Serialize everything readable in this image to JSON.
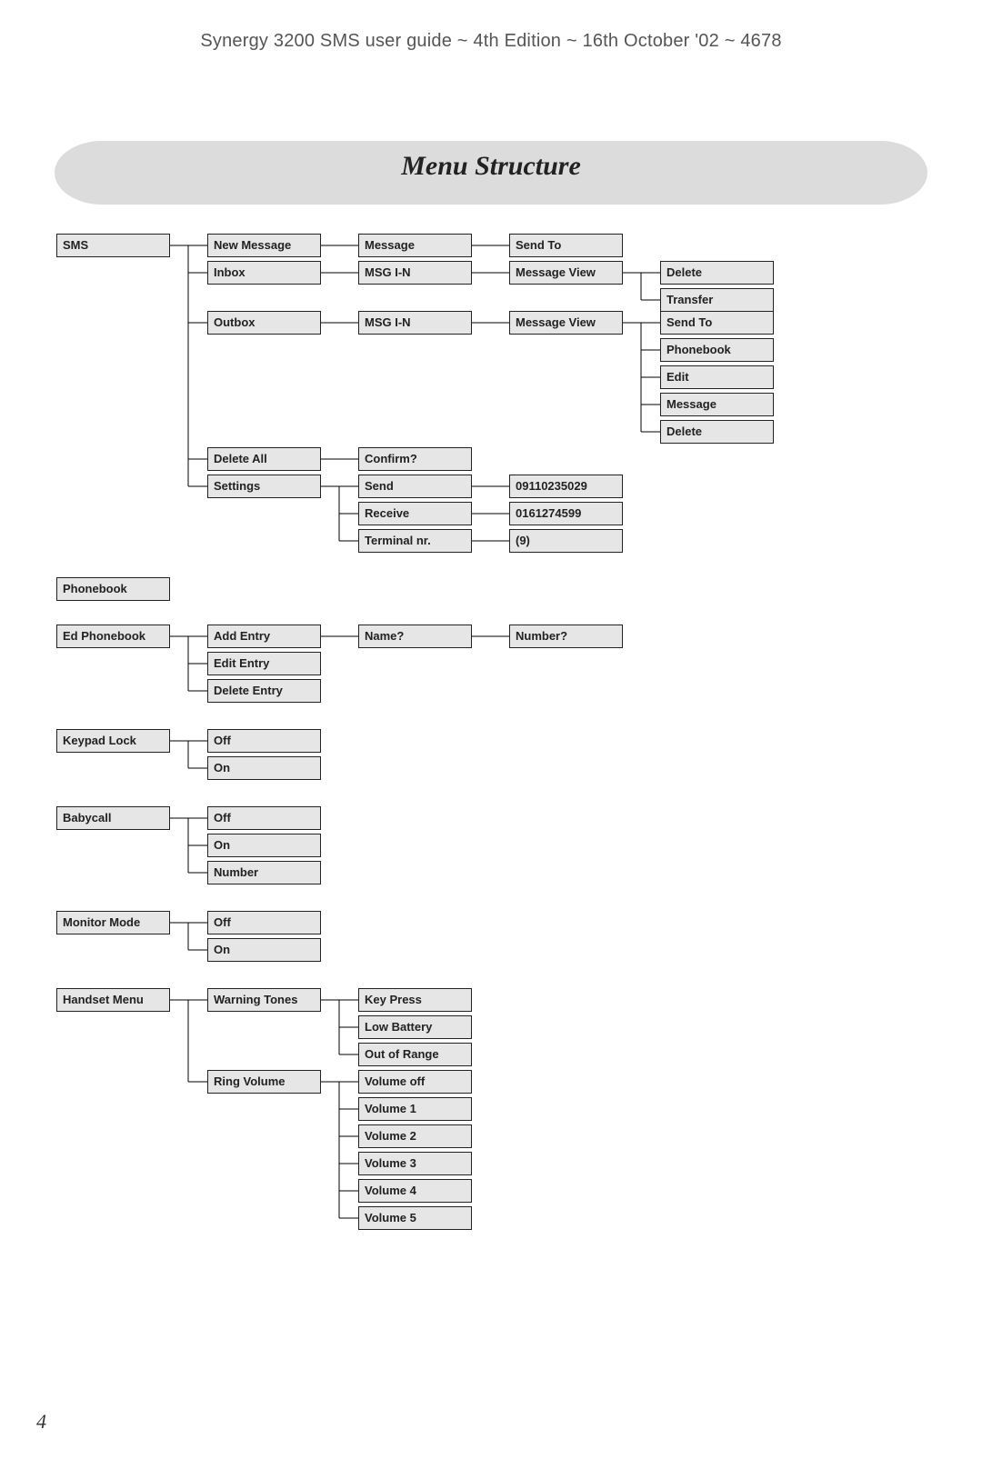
{
  "header": {
    "doc_title": "Synergy 3200 SMS user guide ~ 4th Edition ~ 16th October '02 ~ 4678",
    "section_title": "Menu Structure",
    "page_number": "4"
  },
  "menu": {
    "sms": {
      "label": "SMS",
      "new_message": {
        "label": "New Message",
        "message": "Message",
        "send_to": "Send To"
      },
      "inbox": {
        "label": "Inbox",
        "msg": "MSG I-N",
        "view": "Message View",
        "actions": {
          "delete": "Delete",
          "transfer": "Transfer"
        }
      },
      "outbox": {
        "label": "Outbox",
        "msg": "MSG I-N",
        "view": "Message View",
        "actions": {
          "send_to": "Send To",
          "phonebook": "Phonebook",
          "edit": "Edit",
          "message": "Message",
          "delete": "Delete"
        }
      },
      "delete_all": {
        "label": "Delete All",
        "confirm": "Confirm?"
      },
      "settings": {
        "label": "Settings",
        "send": {
          "label": "Send",
          "value": "09110235029"
        },
        "receive": {
          "label": "Receive",
          "value": "0161274599"
        },
        "terminal": {
          "label": "Terminal nr.",
          "value": "(9)"
        }
      }
    },
    "phonebook": {
      "label": "Phonebook"
    },
    "ed_phonebook": {
      "label": "Ed Phonebook",
      "add": {
        "label": "Add Entry",
        "name": "Name?",
        "number": "Number?"
      },
      "edit": "Edit Entry",
      "delete": "Delete Entry"
    },
    "keypad_lock": {
      "label": "Keypad Lock",
      "off": "Off",
      "on": "On"
    },
    "babycall": {
      "label": "Babycall",
      "off": "Off",
      "on": "On",
      "number": "Number"
    },
    "monitor_mode": {
      "label": "Monitor Mode",
      "off": "Off",
      "on": "On"
    },
    "handset_menu": {
      "label": "Handset Menu",
      "warning_tones": {
        "label": "Warning Tones",
        "key_press": "Key Press",
        "low_battery": "Low Battery",
        "out_of_range": "Out of Range"
      },
      "ring_volume": {
        "label": "Ring Volume",
        "v_off": "Volume off",
        "v1": "Volume 1",
        "v2": "Volume 2",
        "v3": "Volume 3",
        "v4": "Volume 4",
        "v5": "Volume 5"
      }
    }
  }
}
